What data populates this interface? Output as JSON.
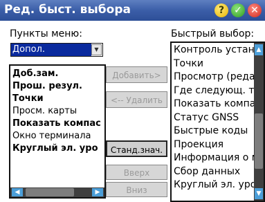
{
  "window": {
    "title": "Ред. быст. выбора"
  },
  "titlebar_icons": [
    "help-icon",
    "ok-icon",
    "close-icon"
  ],
  "left_panel": {
    "label": "Пункты меню:",
    "combo_value": "Допол.",
    "items": [
      {
        "text": "Доб.зам.",
        "bold": true
      },
      {
        "text": "Прош. резул.",
        "bold": true
      },
      {
        "text": "Точки",
        "bold": true
      },
      {
        "text": "Просм. карты",
        "bold": false
      },
      {
        "text": "Показать компас",
        "bold": true
      },
      {
        "text": "Окно терминала",
        "bold": false
      },
      {
        "text": "Круглый эл. уро",
        "bold": true
      }
    ]
  },
  "buttons": {
    "add": "Добавить>",
    "remove": "<-- Удалить",
    "standard": "Станд.знач.",
    "up": "Вверх",
    "down": "Вниз"
  },
  "right_panel": {
    "label": "Быстрый выбор:",
    "items": [
      "Контроль устан",
      "Точки",
      "Просмотр (реда",
      "Где следующ. то",
      "Показать компа",
      "Статус GNSS",
      "Быстрые коды",
      "Проекция",
      "Информация о м",
      "Сбор данных",
      "Круглый эл. уро"
    ]
  },
  "colors": {
    "titlebar": "#3b5ea8",
    "selection": "#0a2a9e",
    "scroll_arrow": "#4b9ed8"
  }
}
